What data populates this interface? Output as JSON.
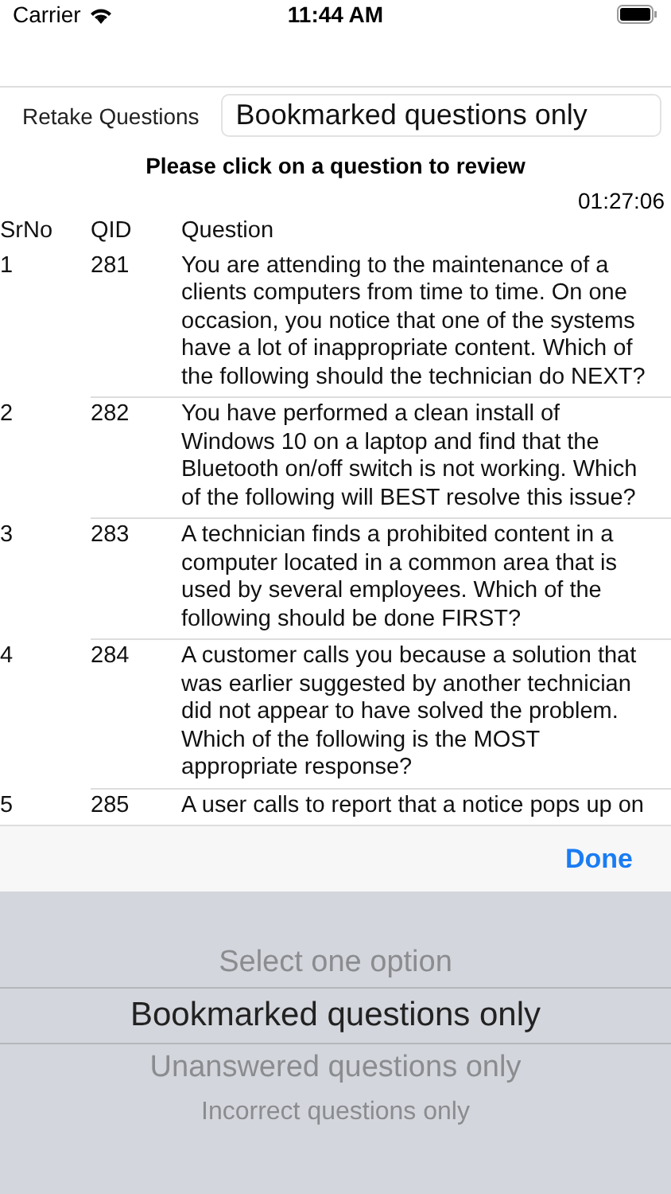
{
  "status_bar": {
    "carrier": "Carrier",
    "time": "11:44 AM"
  },
  "retake": {
    "label": "Retake Questions",
    "value": "Bookmarked questions only"
  },
  "instruction": "Please click on a question to review",
  "timer": "01:27:06",
  "table": {
    "columns": [
      "SrNo",
      "QID",
      "Question"
    ],
    "rows": [
      {
        "srno": "1",
        "qid": "281",
        "question": "You are attending to the maintenance of a clients computers from time to time. On one occasion, you notice that one of the systems have a lot of inappropriate content. Which of the following should the technician do NEXT?"
      },
      {
        "srno": "2",
        "qid": "282",
        "question": "You have performed a clean install of Windows 10 on a laptop and find that the Bluetooth on/off switch is not working. Which of the following will BEST resolve this issue?"
      },
      {
        "srno": "3",
        "qid": "283",
        "question": "A technician finds a prohibited content in a computer located in a common area that is used by several employees. Which of the following should be done FIRST?"
      },
      {
        "srno": "4",
        "qid": "284",
        "question": "A customer calls you because a solution that was earlier suggested by another technician did not appear to have solved the problem. Which of the following is the MOST appropriate response?"
      },
      {
        "srno": "5",
        "qid": "285",
        "question": "A user calls to report that a notice pops up on"
      }
    ]
  },
  "picker": {
    "done": "Done",
    "options": [
      {
        "label": "Select one option",
        "selected": false
      },
      {
        "label": "Bookmarked questions only",
        "selected": true
      },
      {
        "label": "Unanswered questions only",
        "selected": false
      },
      {
        "label": "Incorrect questions only",
        "selected": false
      }
    ]
  }
}
